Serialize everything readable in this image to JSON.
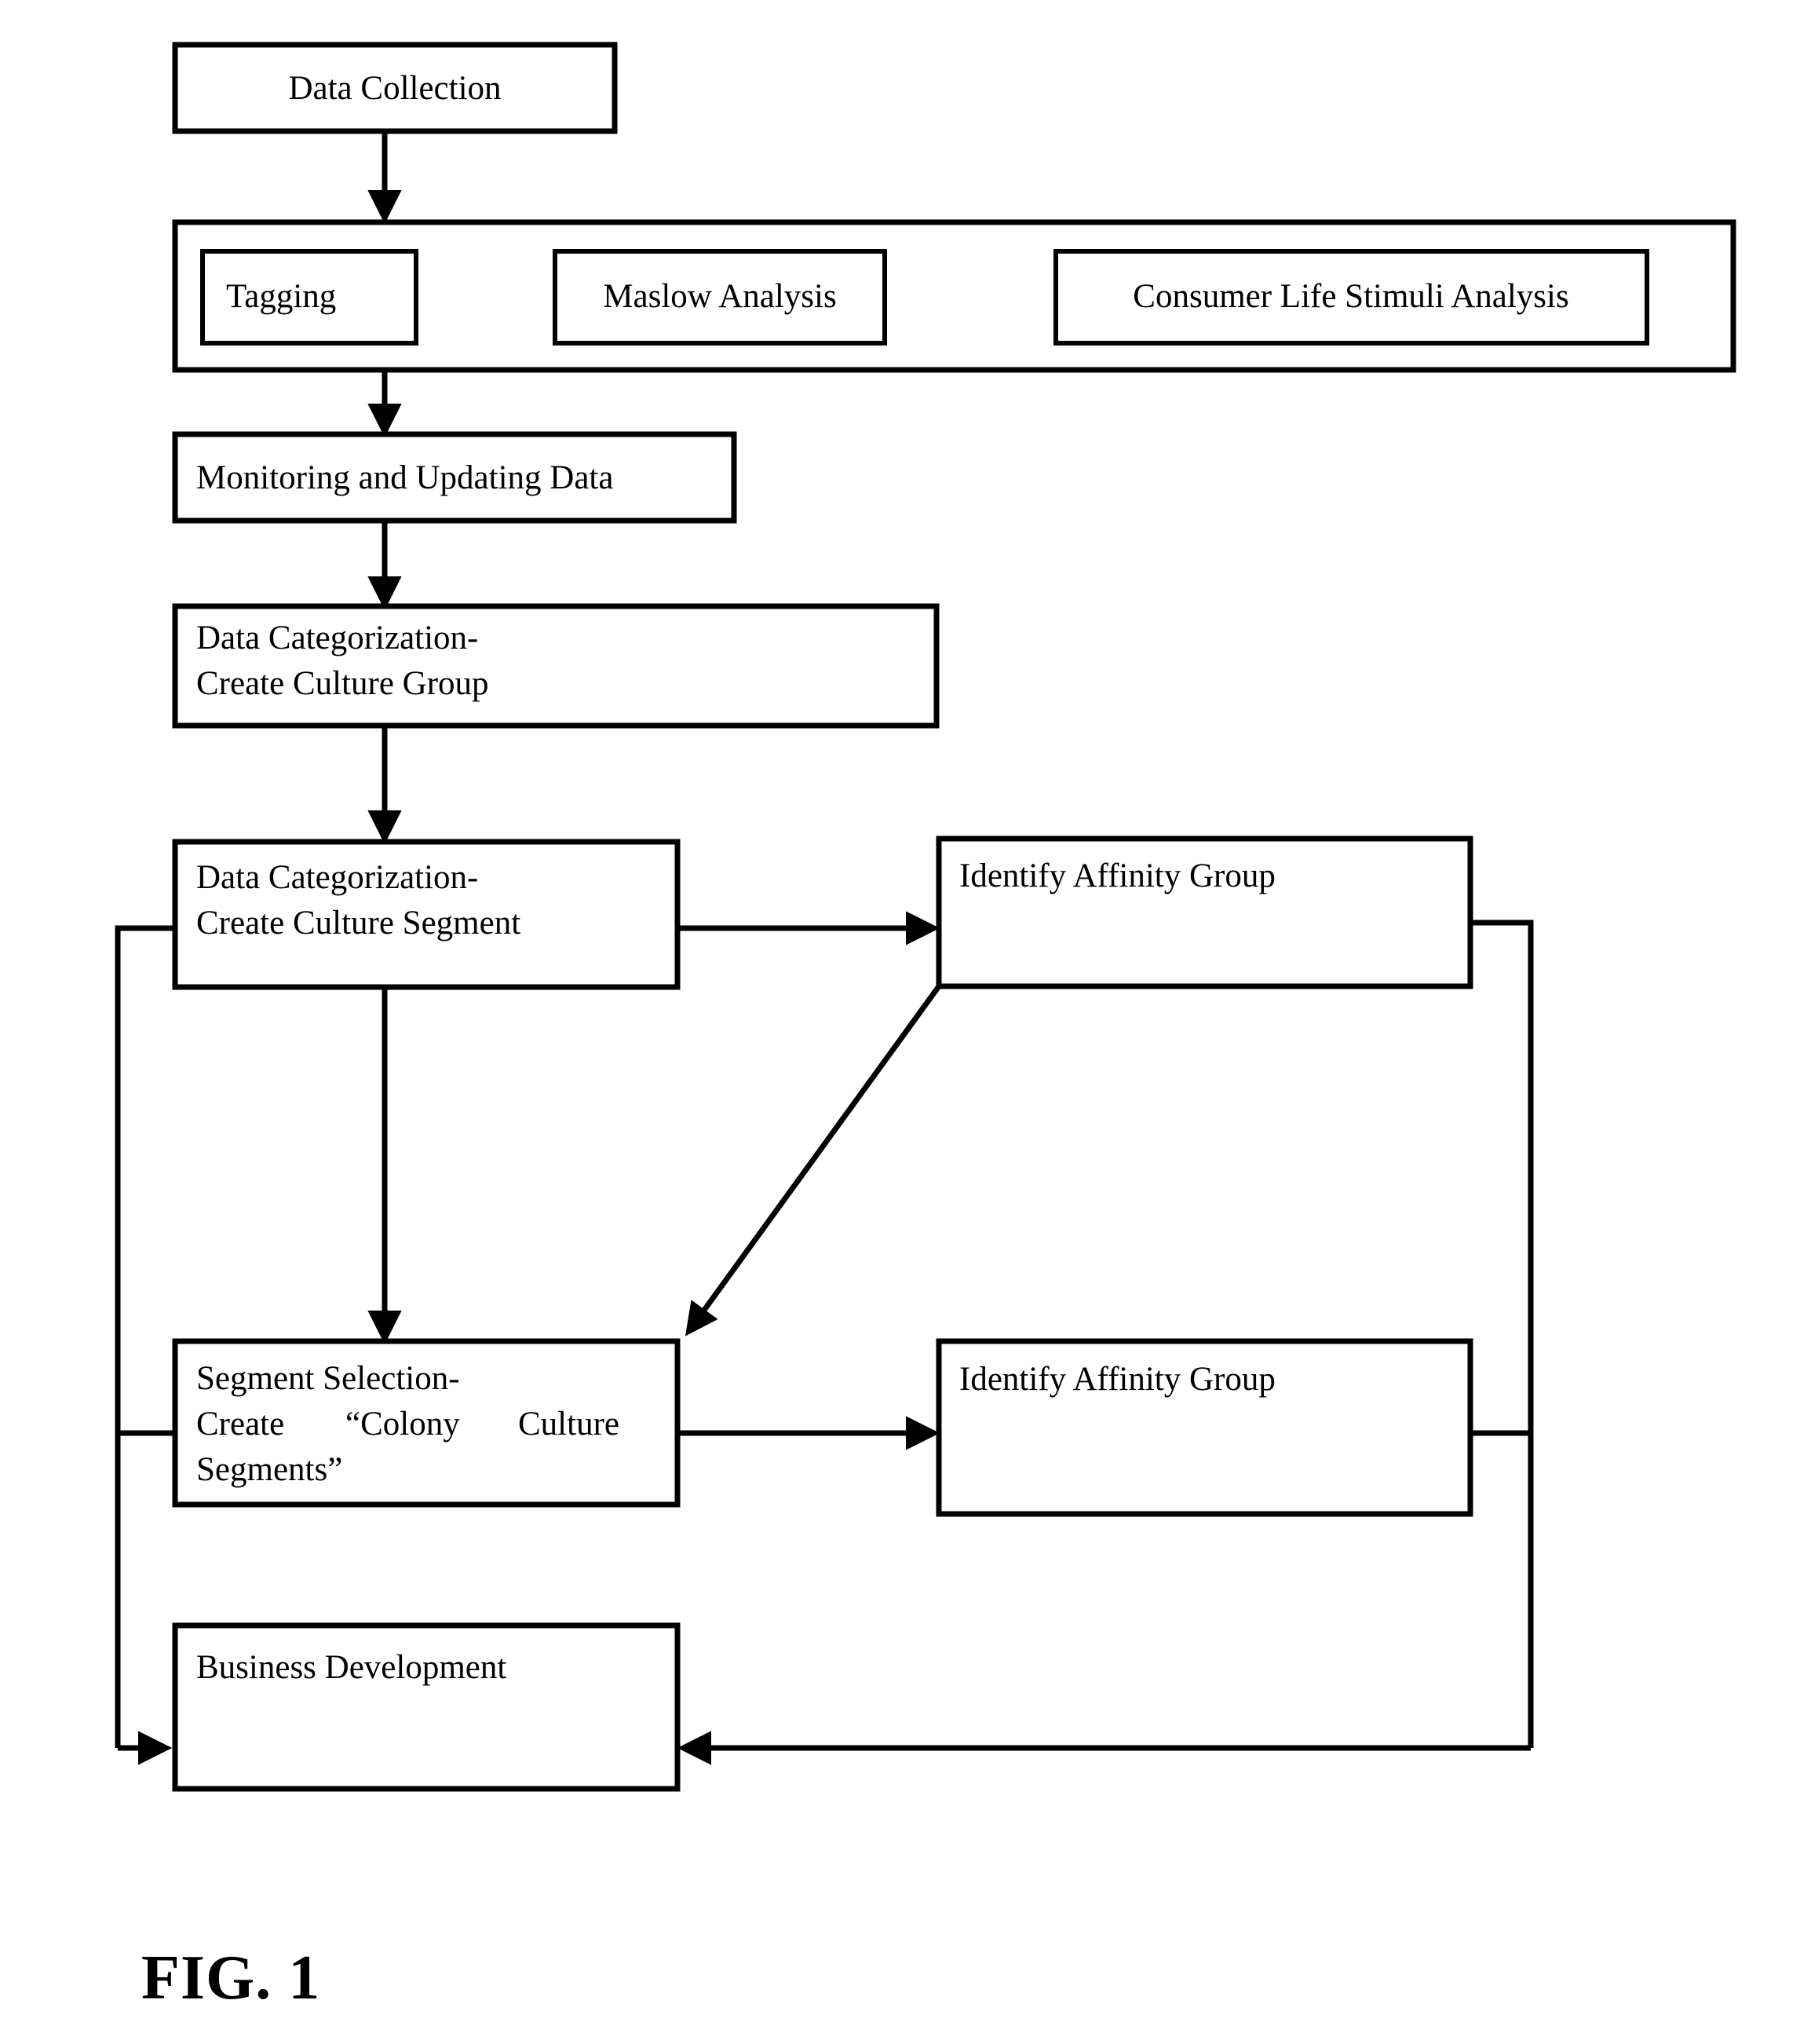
{
  "figure": {
    "caption": "FIG. 1",
    "type": "process-flow-diagram",
    "colors": {
      "stroke": "#000000",
      "fill": "#ffffff",
      "text": "#000000"
    }
  },
  "nodes": {
    "data_collection": {
      "label": "Data Collection"
    },
    "analysis_container": {
      "label": ""
    },
    "tagging": {
      "label": "Tagging"
    },
    "maslow_analysis": {
      "label": "Maslow Analysis"
    },
    "consumer_life_stimuli": {
      "label": "Consumer Life Stimuli Analysis"
    },
    "monitoring": {
      "label": "Monitoring and Updating Data"
    },
    "culture_group": {
      "line1": "Data Categorization-",
      "line2": "Create Culture Group"
    },
    "culture_segment": {
      "line1": "Data Categorization-",
      "line2": "Create Culture Segment"
    },
    "affinity_group_top": {
      "label": "Identify Affinity Group"
    },
    "segment_selection": {
      "line1": "Segment Selection-",
      "line2_a": "Create",
      "line2_b": "“Colony",
      "line2_c": "Culture",
      "line3": "Segments”"
    },
    "affinity_group_bottom": {
      "label": "Identify Affinity Group"
    },
    "business_development": {
      "label": "Business Development"
    }
  },
  "connections": [
    {
      "from": "data_collection",
      "to": "analysis_container",
      "kind": "arrow-down"
    },
    {
      "from": "tagging",
      "to": "maslow_analysis",
      "kind": "double-arrow-horizontal"
    },
    {
      "from": "maslow_analysis",
      "to": "consumer_life_stimuli",
      "kind": "double-arrow-horizontal"
    },
    {
      "from": "analysis_container",
      "to": "monitoring",
      "kind": "arrow-down"
    },
    {
      "from": "monitoring",
      "to": "culture_group",
      "kind": "arrow-down"
    },
    {
      "from": "culture_group",
      "to": "culture_segment",
      "kind": "arrow-down"
    },
    {
      "from": "culture_segment",
      "to": "affinity_group_top",
      "kind": "arrow-right"
    },
    {
      "from": "culture_segment",
      "to": "segment_selection",
      "kind": "arrow-down"
    },
    {
      "from": "affinity_group_top",
      "to": "segment_selection",
      "kind": "arrow-diagonal"
    },
    {
      "from": "segment_selection",
      "to": "affinity_group_bottom",
      "kind": "arrow-right"
    },
    {
      "from": "culture_segment",
      "to": "business_development",
      "kind": "feedback-left"
    },
    {
      "from": "segment_selection",
      "to": "business_development",
      "kind": "feedback-left"
    },
    {
      "from": "affinity_group_top",
      "to": "business_development",
      "kind": "feedback-right"
    },
    {
      "from": "affinity_group_bottom",
      "to": "business_development",
      "kind": "feedback-right"
    }
  ]
}
